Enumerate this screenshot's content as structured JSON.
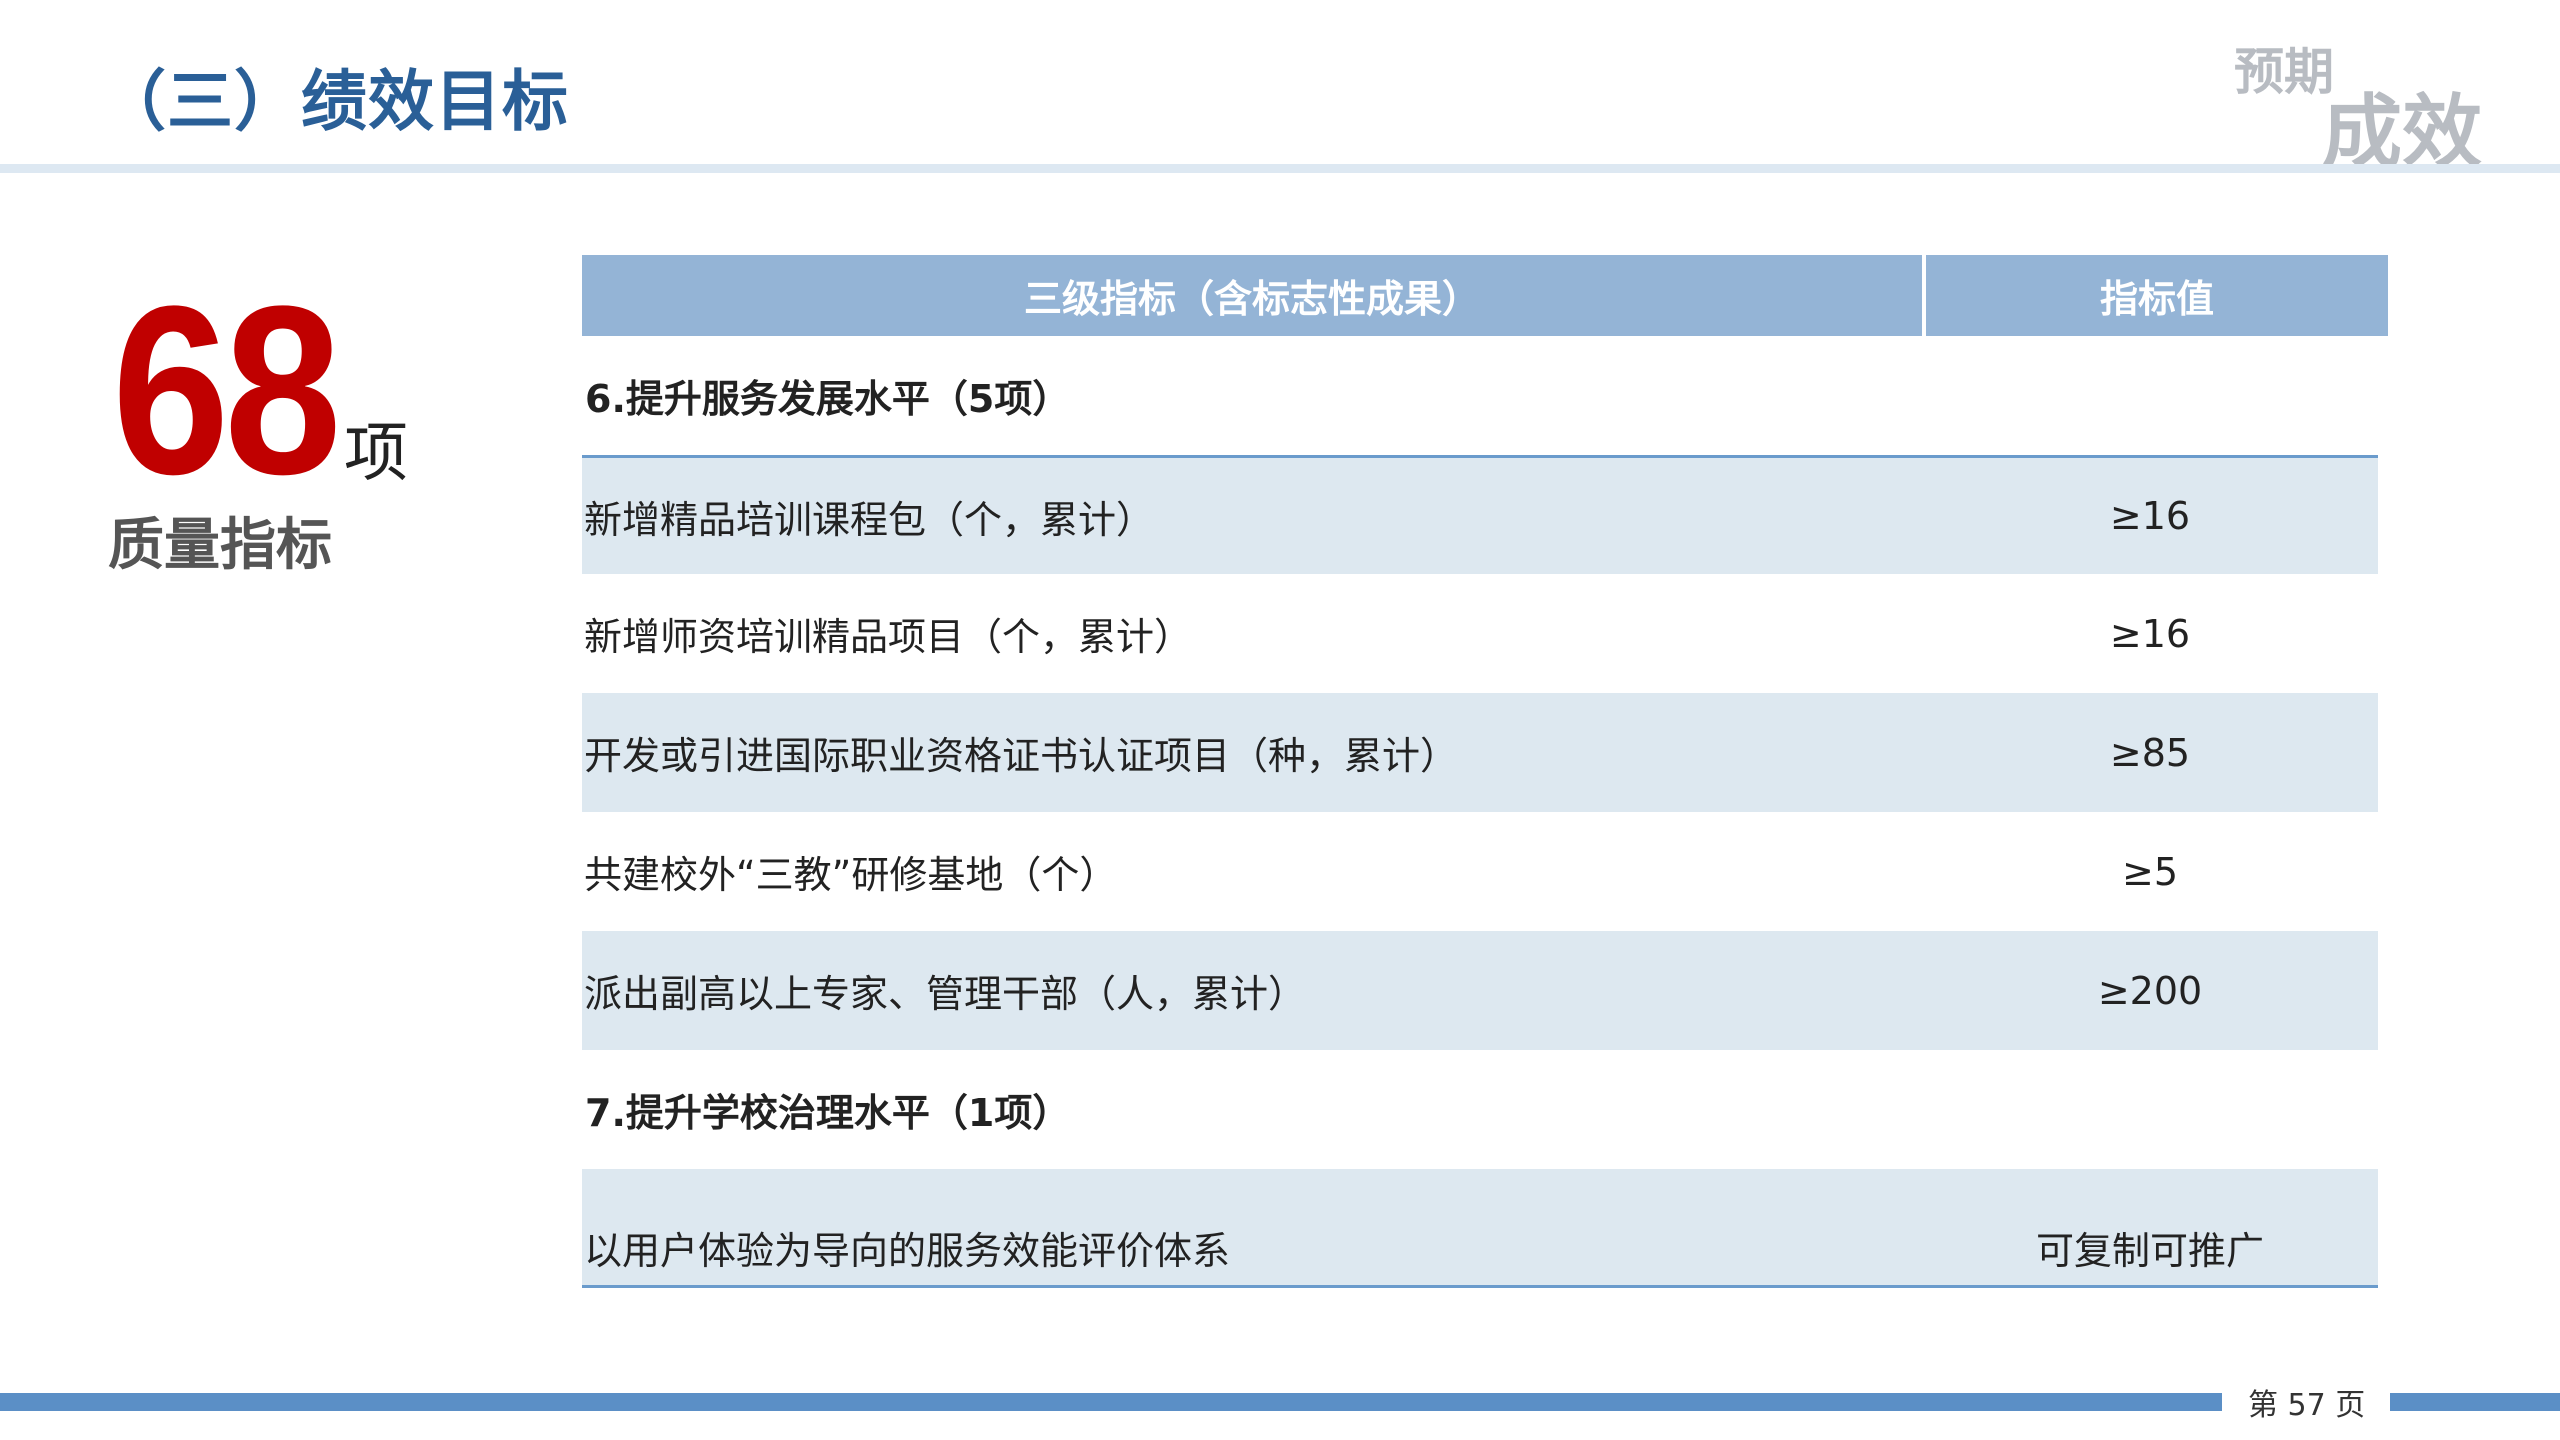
{
  "header": {
    "title": "（三）绩效目标",
    "corner_small": "预期",
    "corner_big": "成效"
  },
  "stat": {
    "number": "68",
    "unit": "项",
    "label": "质量指标"
  },
  "table": {
    "headers": [
      "三级指标（含标志性成果）",
      "指标值"
    ],
    "sections": [
      {
        "title": "6.提升服务发展水平（5项）",
        "rows": [
          {
            "name": "新增精品培训课程包（个，累计）",
            "value": "≥16"
          },
          {
            "name": "新增师资培训精品项目（个，累计）",
            "value": "≥16"
          },
          {
            "name": "开发或引进国际职业资格证书认证项目（种，累计）",
            "value": "≥85"
          },
          {
            "name": "共建校外“三教”研修基地（个）",
            "value": "≥5"
          },
          {
            "name": "派出副高以上专家、管理干部（人，累计）",
            "value": "≥200"
          }
        ]
      },
      {
        "title": "7.提升学校治理水平（1项）",
        "rows": [
          {
            "name": "以用户体验为导向的服务效能评价体系",
            "value": "可复制可推广"
          }
        ]
      }
    ]
  },
  "footer": {
    "page": "第 57 页"
  }
}
